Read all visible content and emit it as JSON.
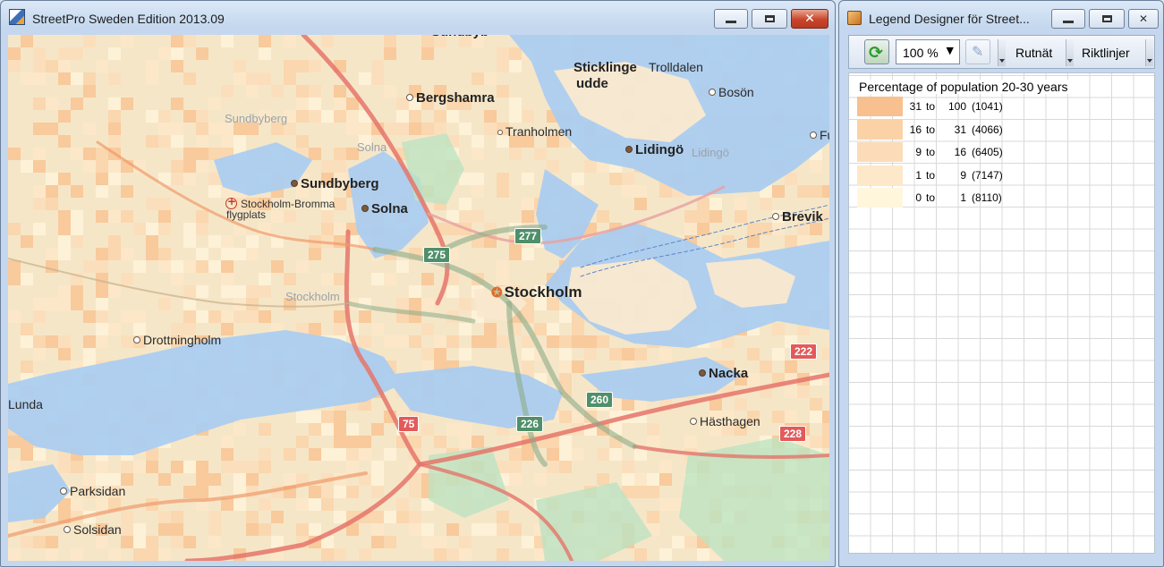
{
  "map_window": {
    "title": "StreetPro Sweden Edition 2013.09",
    "places": [
      {
        "text": "Sundbyberg",
        "style": "ghost"
      },
      {
        "text": "Bergshamra",
        "style": "big"
      },
      {
        "text": "Sticklinge",
        "style": "big"
      },
      {
        "text": "udde",
        "style": "big"
      },
      {
        "text": "Trolldalen",
        "style": "normal"
      },
      {
        "text": "Bosön",
        "style": "normal"
      },
      {
        "text": "Tranholmen",
        "style": "normal"
      },
      {
        "text": "Solna",
        "style": "ghost"
      },
      {
        "text": "Lidingö",
        "style": "big"
      },
      {
        "text": "Lidingö",
        "style": "ghost"
      },
      {
        "text": "Fur",
        "style": "normal"
      },
      {
        "text": "Sundbyberg",
        "style": "big"
      },
      {
        "text": "Stockholm-Bromma",
        "style": "small"
      },
      {
        "text": "flygplats",
        "style": "small"
      },
      {
        "text": "Solna",
        "style": "big"
      },
      {
        "text": "Brevik",
        "style": "big"
      },
      {
        "text": "Stockholm",
        "style": "ghost"
      },
      {
        "text": "Stockholm",
        "style": "city"
      },
      {
        "text": "Drottningholm",
        "style": "normal"
      },
      {
        "text": "Nacka",
        "style": "big"
      },
      {
        "text": "Lunda",
        "style": "normal"
      },
      {
        "text": "Hästhagen",
        "style": "normal"
      },
      {
        "text": "Parksidan",
        "style": "normal"
      },
      {
        "text": "Solsidan",
        "style": "normal"
      },
      {
        "text": "Sundbyb",
        "style": "big"
      }
    ],
    "shields": [
      {
        "text": "275",
        "color": "green"
      },
      {
        "text": "277",
        "color": "green"
      },
      {
        "text": "260",
        "color": "green"
      },
      {
        "text": "226",
        "color": "green"
      },
      {
        "text": "75",
        "color": "red"
      },
      {
        "text": "222",
        "color": "red"
      },
      {
        "text": "228",
        "color": "red"
      }
    ]
  },
  "legend_window": {
    "title": "Legend Designer för Street...",
    "toolbar": {
      "zoom_value": "100 %",
      "grid_label": "Rutnät",
      "guides_label": "Riktlinjer"
    },
    "legend": {
      "title": "Percentage of population 20-30 years",
      "rows": [
        {
          "from": "31",
          "sep": "to",
          "to": "100",
          "count": "(1041)",
          "color": "#f8c08e"
        },
        {
          "from": "16",
          "sep": "to",
          "to": "31",
          "count": "(4066)",
          "color": "#fbd2a6"
        },
        {
          "from": "9",
          "sep": "to",
          "to": "16",
          "count": "(6405)",
          "color": "#fcdcb8"
        },
        {
          "from": "1",
          "sep": "to",
          "to": "9",
          "count": "(7147)",
          "color": "#fde8c9"
        },
        {
          "from": "0",
          "sep": "to",
          "to": "1",
          "count": "(8110)",
          "color": "#fff6dc"
        }
      ]
    }
  },
  "colors": {
    "water": "#a9cdf2",
    "land": "#f6e6c8",
    "road_major": "#e5746a",
    "road_green": "#8bab88"
  }
}
